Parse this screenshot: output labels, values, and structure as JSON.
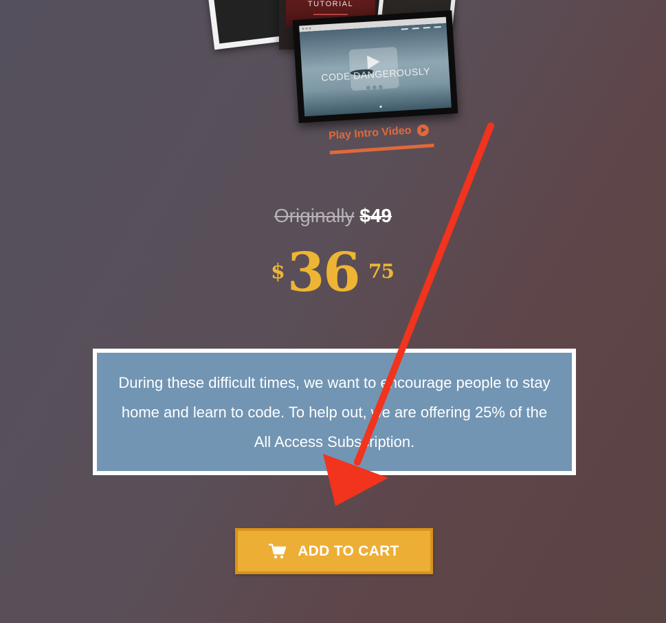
{
  "covers": {
    "tutorial_title": "TUTORIAL",
    "video_title": "CODE DANGEROUSLY"
  },
  "intro_video": {
    "label": "Play Intro Video",
    "icon": "play-circle-icon"
  },
  "pricing": {
    "original_label": "Originally",
    "original_price": "$49",
    "currency": "$",
    "dollars": "36",
    "cents": "75",
    "accent_color": "#eeb534"
  },
  "message": {
    "text": "During these difficult times, we want to encourage people to stay home and learn to code. To help out, we are offering 25% of the All Access Subscription."
  },
  "cart": {
    "label": "ADD TO CART",
    "icon": "shopping-cart-icon",
    "color": "#ecae35"
  },
  "annotation": {
    "arrow_color": "#f2331d"
  }
}
